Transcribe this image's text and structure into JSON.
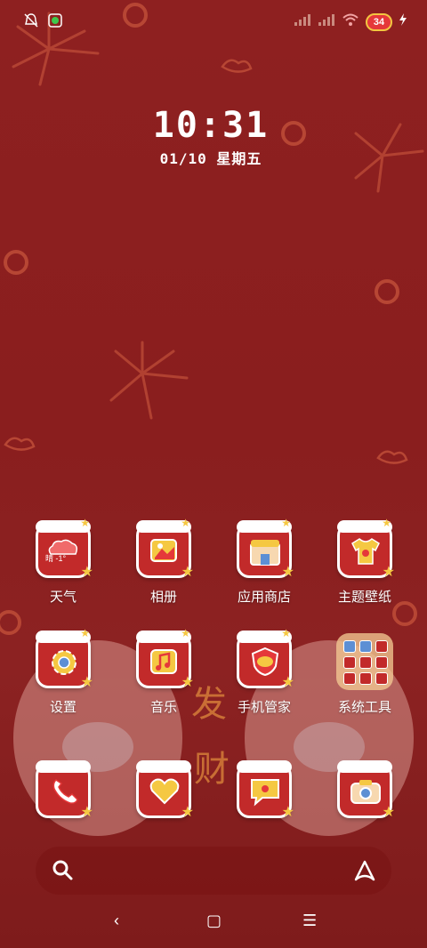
{
  "status_bar": {
    "icons_left": [
      "mute-bell-icon",
      "wechat-notification-icon"
    ],
    "icons_right": [
      "signal-1-icon",
      "signal-2-icon",
      "wifi-icon",
      "battery-icon",
      "charging-icon"
    ],
    "battery_level": "34"
  },
  "clock": {
    "time": "10:31",
    "date": "01/10  星期五"
  },
  "apps": [
    {
      "label": "天气",
      "icon": "weather-icon",
      "sub": "晴 -1°"
    },
    {
      "label": "相册",
      "icon": "gallery-icon"
    },
    {
      "label": "应用商店",
      "icon": "app-store-icon"
    },
    {
      "label": "主题壁纸",
      "icon": "theme-icon"
    },
    {
      "label": "设置",
      "icon": "settings-gear-icon"
    },
    {
      "label": "音乐",
      "icon": "music-icon"
    },
    {
      "label": "手机管家",
      "icon": "security-icon"
    },
    {
      "label": "系统工具",
      "icon": "folder-icon"
    }
  ],
  "dock": [
    {
      "icon": "phone-icon"
    },
    {
      "icon": "browser-icon"
    },
    {
      "icon": "messages-icon"
    },
    {
      "icon": "camera-icon"
    }
  ],
  "wallpaper_text": "发财",
  "search": {
    "left_icon": "search-icon",
    "right_icon": "assistant-icon"
  },
  "navbar": {
    "back": "‹",
    "home": "▢",
    "recent": "☰"
  },
  "colors": {
    "background": "#8e2020",
    "icon_red": "#c22a2a",
    "accent_gold": "#f5c842"
  }
}
